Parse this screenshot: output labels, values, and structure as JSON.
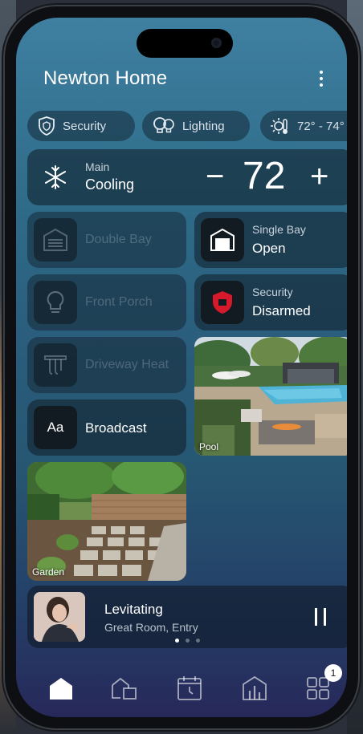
{
  "app": {
    "title": "Newton Home"
  },
  "quick_chips": [
    {
      "label": "Security",
      "icon": "shield-icon"
    },
    {
      "label": "Lighting",
      "icon": "bulbs-icon"
    },
    {
      "label": "72° - 74°",
      "icon": "sun-thermometer-icon"
    }
  ],
  "thermostat": {
    "name": "Main",
    "mode": "Cooling",
    "temperature": "72",
    "minus": "−",
    "plus": "+"
  },
  "tiles": {
    "double_bay": {
      "label": "Double Bay",
      "icon": "garage-closed-icon"
    },
    "single_bay": {
      "title": "Single Bay",
      "state": "Open",
      "icon": "garage-open-icon"
    },
    "front_porch": {
      "label": "Front Porch",
      "icon": "lightbulb-icon"
    },
    "security": {
      "title": "Security",
      "state": "Disarmed",
      "icon": "shield-alert-icon",
      "accent": "#d7192c"
    },
    "driveway_heat": {
      "label": "Driveway Heat",
      "icon": "heater-icon"
    },
    "broadcast": {
      "label": "Broadcast",
      "icon_text": "Aa"
    },
    "pool": {
      "caption": "Pool"
    },
    "garden": {
      "caption": "Garden"
    }
  },
  "now_playing": {
    "song": "Levitating",
    "rooms": "Great Room, Entry",
    "page": 1,
    "pages": 3
  },
  "tabbar": {
    "items": [
      {
        "name": "home",
        "icon": "home-icon",
        "active": true
      },
      {
        "name": "rooms",
        "icon": "rooms-icon"
      },
      {
        "name": "schedule",
        "icon": "calendar-clock-icon"
      },
      {
        "name": "energy",
        "icon": "building-chart-icon"
      },
      {
        "name": "more",
        "icon": "grid-icon"
      }
    ],
    "badge": "1"
  },
  "colors": {
    "screen_top": "#3f7fa0",
    "screen_bottom": "#27285a",
    "accent_red": "#d7192c"
  }
}
